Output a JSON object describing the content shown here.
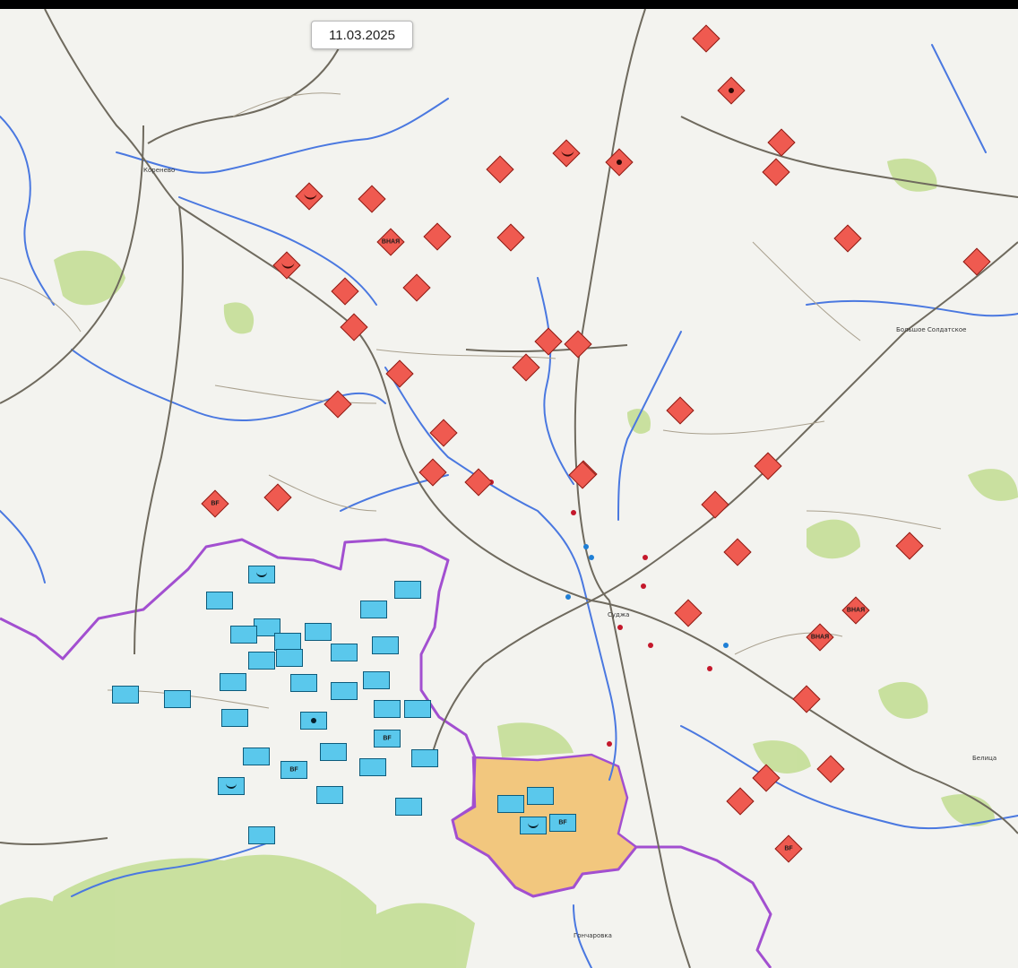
{
  "map": {
    "date": "11.03.2025",
    "colors": {
      "background": "#f3f3ef",
      "russian_units": "#ef5a50",
      "ukrainian_units": "#5ac8ec",
      "border": "#a24fd0",
      "contested_area": "#f1b858",
      "forest": "#c4de96",
      "river": "#4a78e0",
      "road": "#6f6a5e"
    },
    "towns": [
      {
        "name": "Коренево"
      },
      {
        "name": "Суджа"
      },
      {
        "name": "Гончаровка"
      },
      {
        "name": "Большое Солдатское"
      },
      {
        "name": "Белица"
      }
    ],
    "russian_units": [
      {
        "symbol": "plain"
      },
      {
        "symbol": "arty"
      },
      {
        "symbol": "plain"
      },
      {
        "symbol": "plain"
      },
      {
        "symbol": "airborne"
      },
      {
        "symbol": "plain"
      },
      {
        "symbol": "arty"
      },
      {
        "symbol": "airborne"
      },
      {
        "symbol": "plain"
      },
      {
        "symbol": "text",
        "label": "ВНАЯ"
      },
      {
        "symbol": "plain"
      },
      {
        "symbol": "plain"
      },
      {
        "symbol": "airborne"
      },
      {
        "symbol": "plain"
      },
      {
        "symbol": "plain"
      },
      {
        "symbol": "plain"
      },
      {
        "symbol": "plain"
      },
      {
        "symbol": "plain"
      },
      {
        "symbol": "plain"
      },
      {
        "symbol": "plain"
      },
      {
        "symbol": "plain"
      },
      {
        "symbol": "plain"
      },
      {
        "symbol": "plain"
      },
      {
        "symbol": "plain"
      },
      {
        "symbol": "plain"
      },
      {
        "symbol": "plain"
      },
      {
        "symbol": "plain"
      },
      {
        "symbol": "text",
        "label": "BF"
      },
      {
        "symbol": "plain"
      },
      {
        "symbol": "plain"
      },
      {
        "symbol": "plain"
      },
      {
        "symbol": "plain"
      },
      {
        "symbol": "text",
        "label": "ВНАЯ"
      },
      {
        "symbol": "plain"
      },
      {
        "symbol": "text",
        "label": "ВНАЯ"
      },
      {
        "symbol": "plain"
      },
      {
        "symbol": "plain"
      },
      {
        "symbol": "plain"
      },
      {
        "symbol": "plain"
      },
      {
        "symbol": "plain"
      },
      {
        "symbol": "plain"
      },
      {
        "symbol": "plain"
      },
      {
        "symbol": "text",
        "label": "BF"
      }
    ],
    "ukrainian_units": [
      {
        "symbol": "airborne"
      },
      {
        "symbol": "plain"
      },
      {
        "symbol": "plain"
      },
      {
        "symbol": "plain"
      },
      {
        "symbol": "plain"
      },
      {
        "symbol": "plain"
      },
      {
        "symbol": "plain"
      },
      {
        "symbol": "plain"
      },
      {
        "symbol": "plain"
      },
      {
        "symbol": "plain"
      },
      {
        "symbol": "plain"
      },
      {
        "symbol": "plain"
      },
      {
        "symbol": "plain"
      },
      {
        "symbol": "plain"
      },
      {
        "symbol": "plain"
      },
      {
        "symbol": "plain"
      },
      {
        "symbol": "plain"
      },
      {
        "symbol": "plain"
      },
      {
        "symbol": "plain"
      },
      {
        "symbol": "arty"
      },
      {
        "symbol": "plain"
      },
      {
        "symbol": "plain"
      },
      {
        "symbol": "text",
        "label": "BF"
      },
      {
        "symbol": "plain"
      },
      {
        "symbol": "plain"
      },
      {
        "symbol": "plain"
      },
      {
        "symbol": "text",
        "label": "BF"
      },
      {
        "symbol": "plain"
      },
      {
        "symbol": "airborne"
      },
      {
        "symbol": "plain"
      },
      {
        "symbol": "plain"
      },
      {
        "symbol": "plain"
      },
      {
        "symbol": "plain"
      },
      {
        "symbol": "plain"
      },
      {
        "symbol": "airborne"
      },
      {
        "symbol": "text",
        "label": "BF"
      }
    ]
  }
}
